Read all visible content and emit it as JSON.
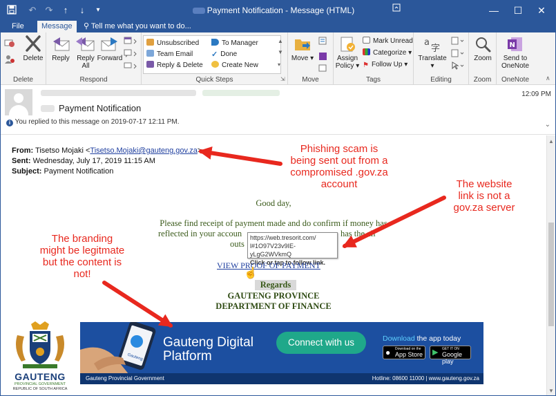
{
  "window": {
    "title": "Payment Notification - Message (HTML)"
  },
  "tabs": [
    {
      "label": "File"
    },
    {
      "label": "Message"
    }
  ],
  "tell_me": "Tell me what you want to do...",
  "ribbon": {
    "delete_group": {
      "label": "Delete",
      "delete_button": "Delete"
    },
    "respond_group": {
      "label": "Respond",
      "reply": "Reply",
      "reply_all_line1": "Reply",
      "reply_all_line2": "All",
      "forward": "Forward"
    },
    "quick_steps": {
      "label": "Quick Steps",
      "items": [
        "Unsubscribed",
        "To Manager",
        "Team Email",
        "Done",
        "Reply & Delete",
        "Create New"
      ]
    },
    "move_group": {
      "label": "Move",
      "move_button": "Move"
    },
    "tags_group": {
      "label": "Tags",
      "assign_policy_line1": "Assign",
      "assign_policy_line2": "Policy",
      "mark_unread": "Mark Unread",
      "categorize": "Categorize",
      "follow_up": "Follow Up"
    },
    "editing_group": {
      "label": "Editing",
      "translate": "Translate"
    },
    "zoom_group": {
      "label": "Zoom",
      "zoom_button": "Zoom"
    },
    "onenote_group": {
      "label": "OneNote",
      "send_line1": "Send to",
      "send_line2": "OneNote"
    }
  },
  "header": {
    "subject": "Payment Notification",
    "replied_note": "You replied to this message on 2019-07-17 12:11 PM.",
    "time": "12:09 PM"
  },
  "message": {
    "from_label": "From:",
    "from_name": "Tisetso Mojaki <",
    "from_email": "Tisetso.Mojaki@gauteng.gov.za",
    "from_end": ">",
    "sent_label": "Sent:",
    "sent_value": "Wednesday, July 17, 2019 11:15 AM",
    "subject_label": "Subject:",
    "subject_value": "Payment Notification",
    "greeting": "Good day,",
    "para_line1": "Please find receipt of payment made and do confirm if money has",
    "para_line2a": "reflected in your accoun",
    "para_line2b": "has the all",
    "para_line3": "outs",
    "link_text": "VIEW PROOF OF PAYMENT",
    "regards": "Regards",
    "sig_line1": "GAUTENG PROVINCE",
    "sig_line2": "DEPARTMENT OF FINANCE"
  },
  "tooltip": {
    "line1": "https://web.tresorit.com/",
    "line2": "l#1O97V23v9IE-yLgG2WVkmQ",
    "line3": "Click or tap to follow link."
  },
  "callouts": {
    "phishing": [
      "Phishing scam is",
      "being sent out from a",
      "compromised .gov.za",
      "account"
    ],
    "website": [
      "The website",
      "link is not a",
      "gov.za server"
    ],
    "branding": [
      "The branding",
      "might be legitmate",
      "but the content is",
      "not!"
    ]
  },
  "banner": {
    "headline1": "Gauteng Digital",
    "headline2": "Platform",
    "connect": "Connect with us",
    "download_prefix": "Download",
    "download_suffix": " the app today",
    "app_store_small": "Download on the",
    "app_store": "App Store",
    "google_small": "GET IT ON",
    "google_play": "Google play",
    "footer_left": "Gauteng Provincial Government",
    "footer_right": "Hotline: 08600 11000  |  www.gauteng.gov.za",
    "phone_text": "Gauteng"
  },
  "logo": {
    "name": "GAUTENG",
    "line1": "PROVINCIAL GOVERNMENT",
    "line2": "REPUBLIC OF SOUTH AFRICA"
  },
  "colors": {
    "title_bar": "#2b579a",
    "callout_red": "#e8281e",
    "banner_blue": "#1c4fa0",
    "connect_green": "#1fa88a",
    "body_text_green": "#3a5a1a"
  }
}
